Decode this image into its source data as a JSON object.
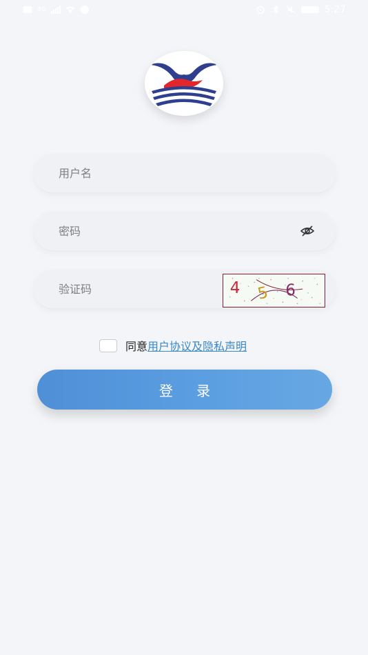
{
  "status_bar": {
    "time": "5:27",
    "signal_text": "4G"
  },
  "login": {
    "username_placeholder": "用户名",
    "password_placeholder": "密码",
    "captcha_placeholder": "验证码",
    "captcha_code": [
      "4",
      "5",
      "6"
    ],
    "agree_prefix": "同意",
    "agree_link": "用户协议及隐私声明",
    "login_button": "登 录"
  }
}
